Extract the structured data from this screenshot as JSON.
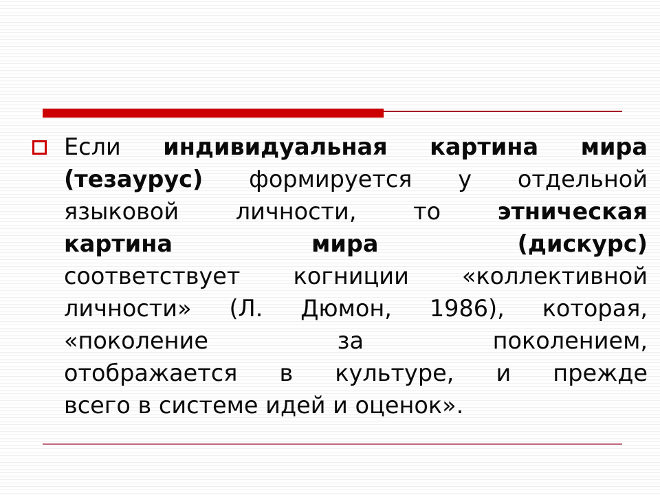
{
  "slide": {
    "background_color": "#fbfbfb",
    "accent_color": "#cc0000",
    "rule_thin_color": "#a41226",
    "bottom_rule_color": "#c2687c",
    "text_color": "#0a0a0a"
  },
  "decor": {
    "top_rule_thick_name": "top-accent-bar",
    "top_rule_thin_name": "top-accent-line",
    "bottom_rule_name": "bottom-accent-line"
  },
  "bullet": {
    "marker": "□",
    "full_text": "Если индивидуальная картина мира (тезаурус) формируется у отдельной языковой личности, то этническая картина мира (дискурс) соответствует когниции «коллективной личности» (Л. Дюмон, 1986), которая, «поколение за поколением, отображается в культуре, и прежде всего в системе идей и оценок».",
    "lines": [
      {
        "segments": [
          {
            "text": "Если",
            "bold": false
          },
          {
            "text": "индивидуальная",
            "bold": true
          },
          {
            "text": "картина",
            "bold": true
          },
          {
            "text": "мира",
            "bold": true
          }
        ]
      },
      {
        "segments": [
          {
            "text": "(тезаурус)",
            "bold": true
          },
          {
            "text": "формируется",
            "bold": false
          },
          {
            "text": "у",
            "bold": false
          },
          {
            "text": "отдельной",
            "bold": false
          }
        ]
      },
      {
        "segments": [
          {
            "text": "языковой",
            "bold": false
          },
          {
            "text": "личности,",
            "bold": false
          },
          {
            "text": "то",
            "bold": false
          },
          {
            "text": "этническая",
            "bold": true
          }
        ]
      },
      {
        "segments": [
          {
            "text": "картина",
            "bold": true
          },
          {
            "text": "мира",
            "bold": true
          },
          {
            "text": "(дискурс)",
            "bold": true
          }
        ]
      },
      {
        "segments": [
          {
            "text": "соответствует",
            "bold": false
          },
          {
            "text": "когниции",
            "bold": false
          },
          {
            "text": "«коллективной",
            "bold": false
          }
        ]
      },
      {
        "segments": [
          {
            "text": "личности»",
            "bold": false
          },
          {
            "text": "(Л.",
            "bold": false
          },
          {
            "text": "Дюмон,",
            "bold": false
          },
          {
            "text": "1986),",
            "bold": false
          },
          {
            "text": "которая,",
            "bold": false
          }
        ]
      },
      {
        "segments": [
          {
            "text": "«поколение",
            "bold": false
          },
          {
            "text": "за",
            "bold": false
          },
          {
            "text": "поколением,",
            "bold": false
          }
        ]
      },
      {
        "segments": [
          {
            "text": "отображается",
            "bold": false
          },
          {
            "text": "в",
            "bold": false
          },
          {
            "text": "культуре,",
            "bold": false
          },
          {
            "text": "и",
            "bold": false
          },
          {
            "text": "прежде",
            "bold": false
          }
        ]
      },
      {
        "segments": [
          {
            "text": "всего в системе идей и оценок».",
            "bold": false
          }
        ]
      }
    ]
  }
}
